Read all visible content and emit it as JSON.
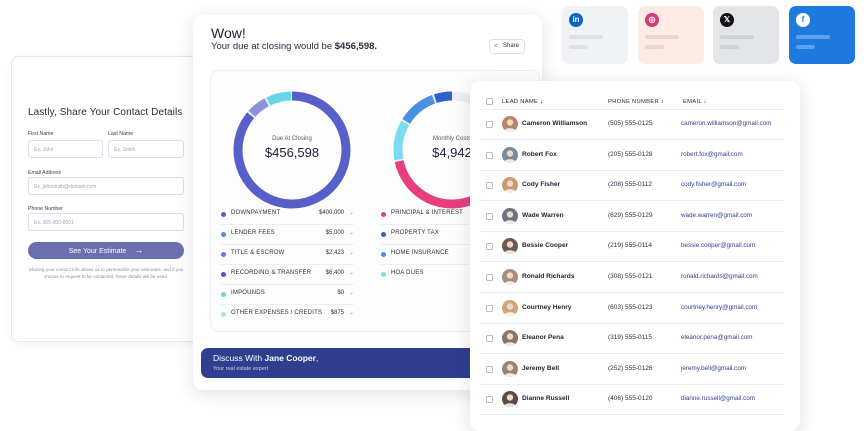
{
  "contact_form": {
    "title": "Lastly, Share Your Contact Details",
    "first_name_label": "First Name",
    "first_name_placeholder": "Ex. John",
    "last_name_label": "Last Name",
    "last_name_placeholder": "Ex. Smith",
    "email_label": "Email Address",
    "email_placeholder": "Ex. johnsmith@domain.com",
    "phone_label": "Phone Number",
    "phone_placeholder": "Ex. 305-000-0001",
    "submit_label": "See Your Estimate",
    "submit_icon": "arrow-right-icon",
    "disclaimer": "Sharing your contact info allows us to personalize your estimates, and if you choose to request to be contacted, these details will be used."
  },
  "summary": {
    "heading": "Wow!",
    "due_prefix": "Your due at closing would be ",
    "due_amount": "$456,598.",
    "share_label": "Share",
    "donut1": {
      "caption": "Due At Closing",
      "value": "$456,598",
      "colors": [
        "#5660c8",
        "#8a92dc",
        "#66d6e4"
      ]
    },
    "donut2": {
      "caption": "Monthly Costs",
      "value": "$4,942",
      "colors": [
        "#e83e7d",
        "#7adcf0",
        "#4a90e2",
        "#2d5fcf"
      ]
    },
    "closing_items": [
      {
        "name": "DOWNPAYMENT",
        "value": "$400,000",
        "color": "#5660c8"
      },
      {
        "name": "LENDER FEES",
        "value": "$5,000",
        "color": "#4a90e2"
      },
      {
        "name": "TITLE & ESCROW",
        "value": "$2,423",
        "color": "#5b7fe0"
      },
      {
        "name": "RECORDING & TRANSFER",
        "value": "$6,400",
        "color": "#3f58c4"
      },
      {
        "name": "IMPOUNDS",
        "value": "$0",
        "color": "#66d6e4"
      },
      {
        "name": "OTHER EXPENSES / CREDITS",
        "value": "$875",
        "color": "#9fe3ea"
      }
    ],
    "monthly_items": [
      {
        "name": "PRINCIPAL & INTEREST",
        "color": "#e83e7d"
      },
      {
        "name": "PROPERTY TAX",
        "color": "#2d5fcf"
      },
      {
        "name": "HOME INSURANCE",
        "color": "#4a90e2"
      },
      {
        "name": "HOA DUES",
        "color": "#7adcf0"
      }
    ],
    "discuss_prefix": "Discuss With ",
    "discuss_name": "Jane Cooper",
    "discuss_suffix": ",",
    "discuss_sub": "Your real estate expert"
  },
  "social": [
    {
      "name": "linkedin",
      "icon": "linkedin-icon",
      "glyph": "in",
      "bg": "#f1f2f5",
      "icon_bg": "#0a66c2",
      "bar": "#dfe1e7"
    },
    {
      "name": "instagram",
      "icon": "instagram-icon",
      "glyph": "◎",
      "bg": "#fbeae6",
      "icon_bg": "#d63a7a",
      "bar": "#ebd4cf"
    },
    {
      "name": "x",
      "icon": "x-icon",
      "glyph": "𝕏",
      "bg": "#e4e5e8",
      "icon_bg": "#111111",
      "bar": "#cfd1d6"
    },
    {
      "name": "facebook",
      "icon": "facebook-icon",
      "glyph": "f",
      "bg": "#1f7ae0",
      "icon_bg": "#ffffff",
      "bar": "#5fa1ee"
    }
  ],
  "leads": {
    "headers": {
      "name": "LEAD NAME",
      "phone": "PHONE NUMBER",
      "email": "EMAIL"
    },
    "rows": [
      {
        "name": "Cameron Williamson",
        "phone": "(505) 555-0125",
        "email": "cameron.williamson@gmail.com",
        "avatar_color": "#b8856a"
      },
      {
        "name": "Robert Fox",
        "phone": "(205) 555-0128",
        "email": "robert.fox@gmail.com",
        "avatar_color": "#7b8a99"
      },
      {
        "name": "Cody Fisher",
        "phone": "(208) 555-0112",
        "email": "cody.fisher@gmail.com",
        "avatar_color": "#c99a6f"
      },
      {
        "name": "Wade Warren",
        "phone": "(629) 555-0129",
        "email": "wade.warren@gmail.com",
        "avatar_color": "#6b7480"
      },
      {
        "name": "Bessie Cooper",
        "phone": "(219) 555-0114",
        "email": "bessie.cooper@gmail.com",
        "avatar_color": "#6e5a55"
      },
      {
        "name": "Ronald Richards",
        "phone": "(308) 555-0121",
        "email": "ronald.richards@gmail.com",
        "avatar_color": "#a88e80"
      },
      {
        "name": "Courtney Henry",
        "phone": "(603) 555-0123",
        "email": "courtney.henry@gmail.com",
        "avatar_color": "#d0a47c"
      },
      {
        "name": "Eleanor Pena",
        "phone": "(319) 555-0115",
        "email": "eleanor.pena@gmail.com",
        "avatar_color": "#8a7468"
      },
      {
        "name": "Jeremy Bell",
        "phone": "(252) 555-0126",
        "email": "jeremy.bell@gmail.com",
        "avatar_color": "#9c8372"
      },
      {
        "name": "Dianne Russell",
        "phone": "(406) 555-0120",
        "email": "dianne.russell@gmail.com",
        "avatar_color": "#5b4a45"
      }
    ]
  }
}
